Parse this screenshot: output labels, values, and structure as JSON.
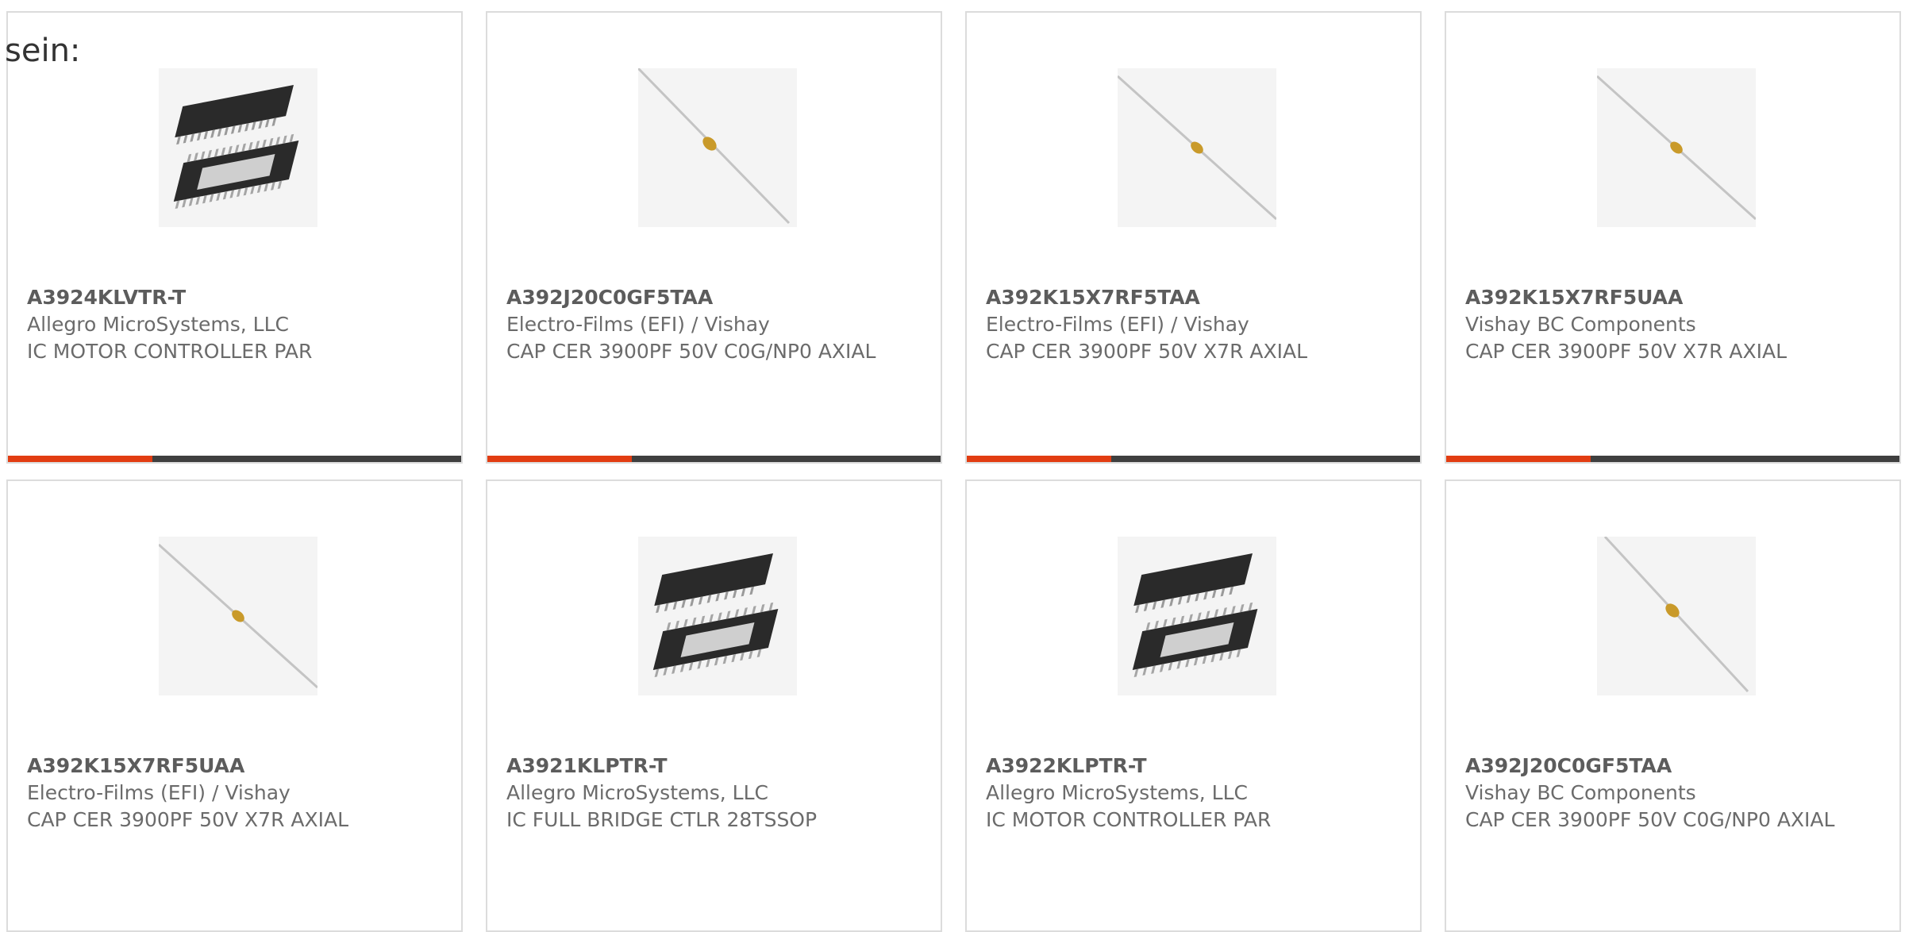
{
  "intro_text": "sein:",
  "colors": {
    "accent": "#e23d12",
    "bar": "#3f3f3f",
    "border": "#dcdcdc",
    "text": "#6b6b6b"
  },
  "products": [
    {
      "part": "A3924KLVTR-T",
      "manufacturer": "Allegro MicroSystems, LLC",
      "description": "IC MOTOR CONTROLLER PAR",
      "image": "ic-chip-icon"
    },
    {
      "part": "A392J20C0GF5TAA",
      "manufacturer": "Electro-Films (EFI) / Vishay",
      "description": "CAP CER 3900PF 50V C0G/NP0 AXIAL",
      "image": "axial-capacitor-icon"
    },
    {
      "part": "A392K15X7RF5TAA",
      "manufacturer": "Electro-Films (EFI) / Vishay",
      "description": "CAP CER 3900PF 50V X7R AXIAL",
      "image": "axial-capacitor-icon"
    },
    {
      "part": "A392K15X7RF5UAA",
      "manufacturer": "Vishay BC Components",
      "description": "CAP CER 3900PF 50V X7R AXIAL",
      "image": "axial-capacitor-icon"
    },
    {
      "part": "A392K15X7RF5UAA",
      "manufacturer": "Electro-Films (EFI) / Vishay",
      "description": "CAP CER 3900PF 50V X7R AXIAL",
      "image": "axial-capacitor-icon"
    },
    {
      "part": "A3921KLPTR-T",
      "manufacturer": "Allegro MicroSystems, LLC",
      "description": "IC FULL BRIDGE CTLR 28TSSOP",
      "image": "ic-chip-icon"
    },
    {
      "part": "A3922KLPTR-T",
      "manufacturer": "Allegro MicroSystems, LLC",
      "description": "IC MOTOR CONTROLLER PAR",
      "image": "ic-chip-icon"
    },
    {
      "part": "A392J20C0GF5TAA",
      "manufacturer": "Vishay BC Components",
      "description": "CAP CER 3900PF 50V C0G/NP0 AXIAL",
      "image": "axial-capacitor-icon"
    }
  ]
}
